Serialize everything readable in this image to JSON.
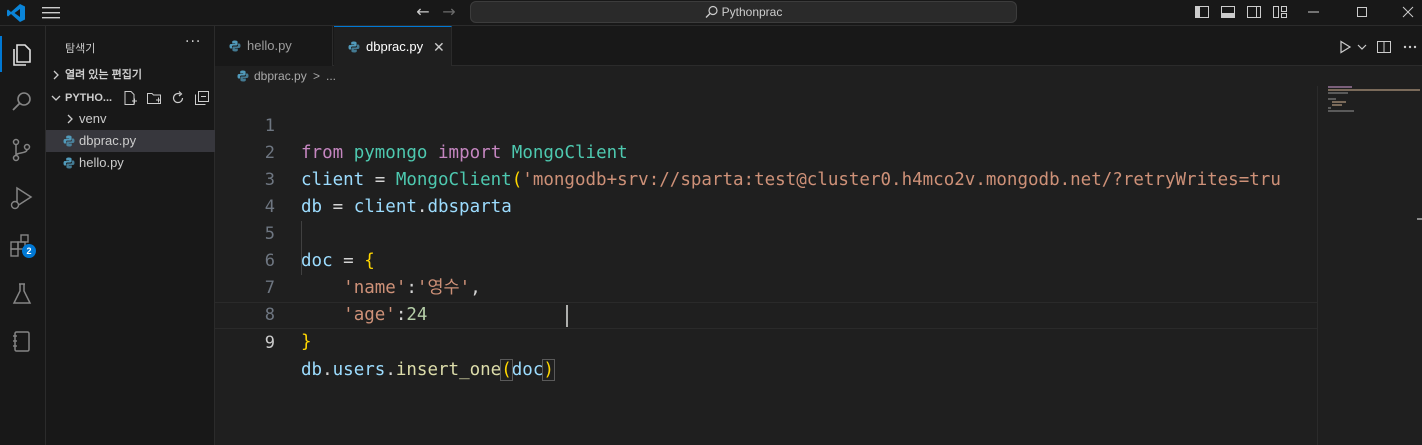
{
  "titlebar": {
    "search_text": "Pythonprac"
  },
  "activity": {
    "extensions_badge": "2"
  },
  "sidebar": {
    "title": "탐색기",
    "more": "···",
    "open_editors_label": "열려 있는 편집기",
    "folder_label": "PYTHO...",
    "items": [
      {
        "label": "venv",
        "type": "folder"
      },
      {
        "label": "dbprac.py",
        "type": "python",
        "selected": true
      },
      {
        "label": "hello.py",
        "type": "python"
      }
    ]
  },
  "tabs": [
    {
      "label": "hello.py",
      "active": false
    },
    {
      "label": "dbprac.py",
      "active": true
    }
  ],
  "breadcrumb": {
    "file": "dbprac.py",
    "sep": ">",
    "rest": "..."
  },
  "editor": {
    "current_line": 9,
    "lines": [
      {
        "num": "1"
      },
      {
        "num": "2"
      },
      {
        "num": "3"
      },
      {
        "num": "4"
      },
      {
        "num": "5"
      },
      {
        "num": "6"
      },
      {
        "num": "7"
      },
      {
        "num": "8"
      },
      {
        "num": "9"
      }
    ],
    "tokens": {
      "l1": [
        "from",
        " ",
        "pymongo",
        " ",
        "import",
        " ",
        "MongoClient"
      ],
      "l2": [
        "client",
        " = ",
        "MongoClient",
        "(",
        "'mongodb+srv://sparta:test@cluster0.h4mco2v.mongodb.net/?retryWrites=tru"
      ],
      "l3": [
        "db",
        " = ",
        "client",
        ".",
        "dbsparta"
      ],
      "l5": [
        "doc",
        " = ",
        "{"
      ],
      "l6": [
        "    ",
        "'name'",
        ":",
        "'영수'",
        ","
      ],
      "l7": [
        "    ",
        "'age'",
        ":",
        "24"
      ],
      "l8": [
        "}"
      ],
      "l9": [
        "db",
        ".",
        "users",
        ".",
        "insert_one",
        "(",
        "doc",
        ")"
      ]
    }
  },
  "colors": {
    "accent": "#0078d4",
    "keyword": "#c586c0",
    "class": "#4ec9b0",
    "variable": "#9cdcfe",
    "function": "#dcdcaa",
    "string": "#ce9178",
    "number": "#b5cea8"
  }
}
